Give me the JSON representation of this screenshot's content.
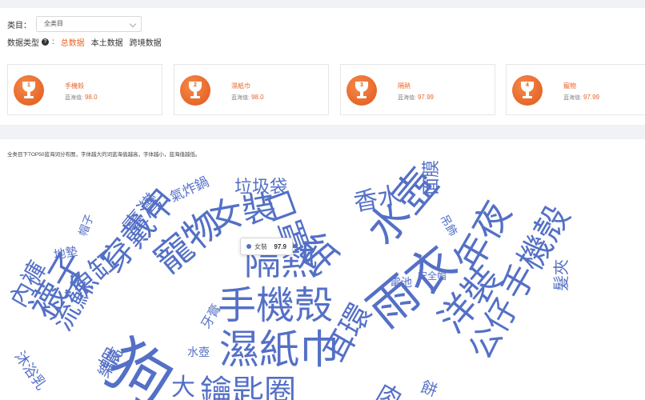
{
  "filter": {
    "category_label": "类目：",
    "category_value": "全类目"
  },
  "data_type": {
    "label": "数据类型",
    "options": [
      "总数据",
      "本土数据",
      "跨境数据"
    ]
  },
  "top_cards": [
    {
      "rank": "1",
      "name": "手機殼",
      "score_label": "蓝海值:",
      "score": "98.0"
    },
    {
      "rank": "2",
      "name": "濕紙巾",
      "score_label": "蓝海值:",
      "score": "98.0"
    },
    {
      "rank": "3",
      "name": "隔熱",
      "score_label": "蓝海值:",
      "score": "97.99"
    },
    {
      "rank": "4",
      "name": "寵物",
      "score_label": "蓝海值:",
      "score": "97.99"
    }
  ],
  "cloud": {
    "description": "全类目下TOP50蓝海词分布图，字体越大的词蓝海值越高，字体越小，蓝海值越低。",
    "words": [
      {
        "text": "垃圾袋"
      },
      {
        "text": "氣炸鍋"
      },
      {
        "text": "女裝"
      },
      {
        "text": "口罩"
      },
      {
        "text": "香水"
      },
      {
        "text": "面膜"
      },
      {
        "text": "帽子"
      },
      {
        "text": "臺灣"
      },
      {
        "text": "穿戴甲"
      },
      {
        "text": "紙"
      },
      {
        "text": "吊飾"
      },
      {
        "text": "流蘇"
      },
      {
        "text": "地墊"
      },
      {
        "text": "魚缸"
      },
      {
        "text": "寵物"
      },
      {
        "text": "隔熱"
      },
      {
        "text": "水壺"
      },
      {
        "text": "安全帽"
      },
      {
        "text": "電池"
      },
      {
        "text": "手機殼"
      },
      {
        "text": "內褲"
      },
      {
        "text": "襪子"
      },
      {
        "text": "狗"
      },
      {
        "text": "雨衣"
      },
      {
        "text": "洋裝"
      },
      {
        "text": "年夜"
      },
      {
        "text": "髮夾"
      },
      {
        "text": "沐浴乳"
      },
      {
        "text": "牙膏"
      },
      {
        "text": "水壺"
      },
      {
        "text": "濕紙巾"
      },
      {
        "text": "耳環"
      },
      {
        "text": "手機殼"
      },
      {
        "text": "公仔"
      },
      {
        "text": "蝦"
      },
      {
        "text": "大"
      },
      {
        "text": "鑰匙圈"
      },
      {
        "text": "樂高"
      },
      {
        "text": "肉"
      },
      {
        "text": "餅"
      }
    ]
  },
  "tooltip": {
    "name": "女裝",
    "value": "97.9"
  }
}
